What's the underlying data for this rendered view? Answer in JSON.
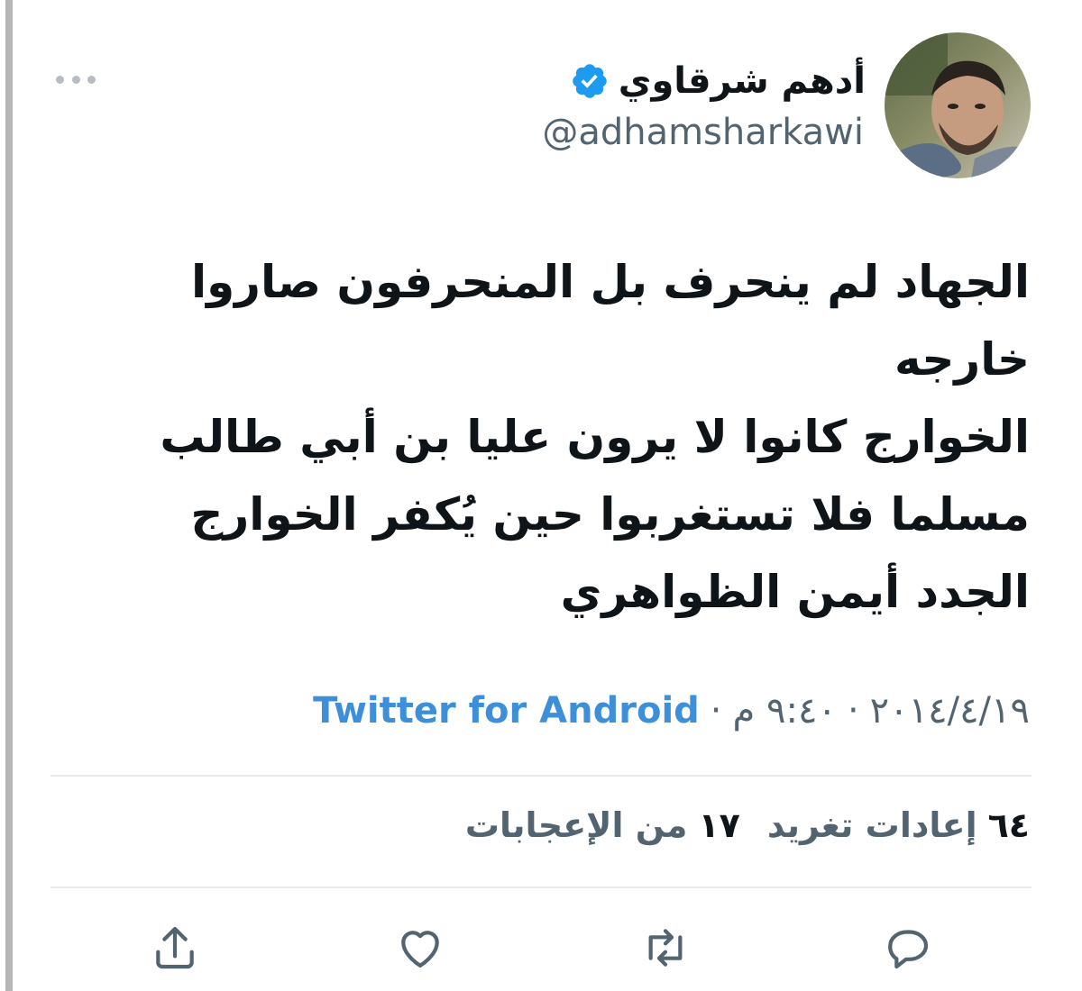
{
  "user": {
    "display_name": "أدهم شرقاوي",
    "handle": "@adhamsharkawi",
    "verified": true
  },
  "tweet": {
    "text": "الجهاد لم ينحرف بل المنحرفون صاروا\nخارجه\nالخوارج كانوا لا يرون عليا بن أبي طالب\nمسلما فلا تستغربوا حين يُكفر الخوارج\nالجدد أيمن الظواهري",
    "date": "٢٠١٤/٤/١٩",
    "time": "٩:٤٠ م",
    "separator": "·",
    "source": "Twitter for Android"
  },
  "stats": {
    "retweets_count": "٦٤",
    "retweets_label": "إعادات تغريد",
    "likes_count": "١٧",
    "likes_label": "من الإعجابات"
  },
  "actions": [
    "reply-icon",
    "retweet-icon",
    "like-icon",
    "share-icon"
  ],
  "colors": {
    "verified": "#1d9bf0",
    "source_link": "#3d8fd9",
    "secondary_text": "#536471",
    "divider": "#e8ebed",
    "icon": "#536471"
  }
}
